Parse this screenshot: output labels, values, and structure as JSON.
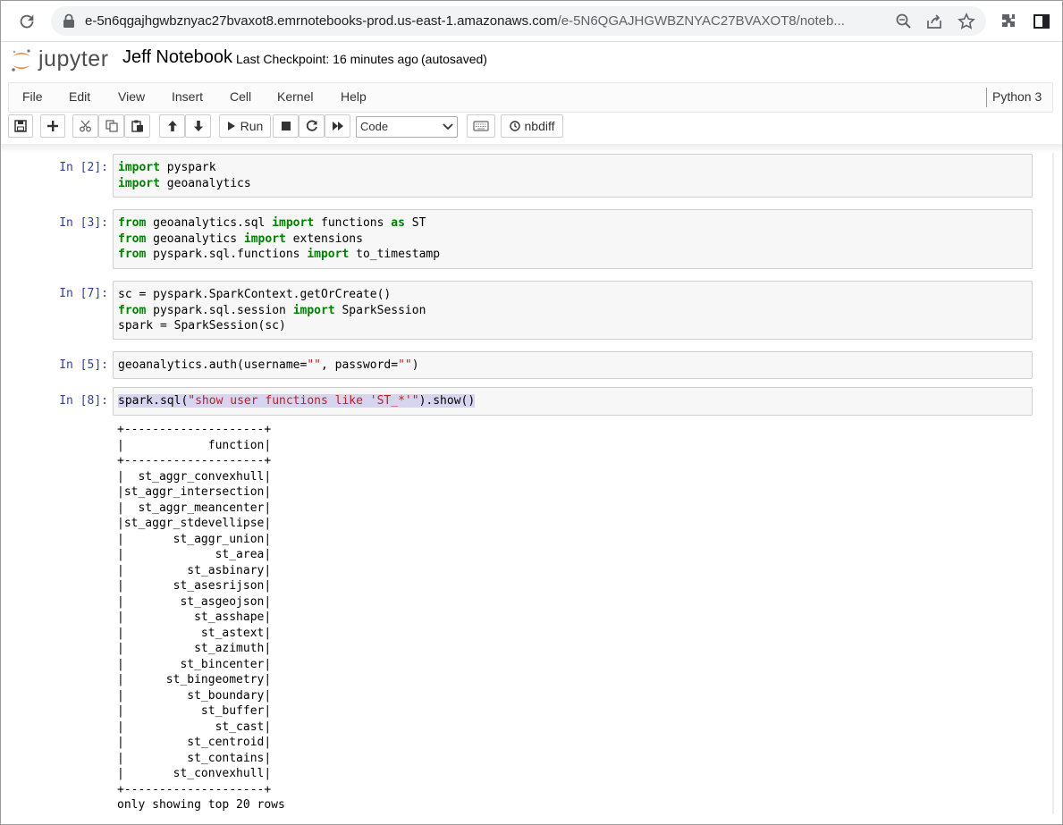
{
  "browser": {
    "url_domain": "e-5n6qgajhgwbznyac27bvaxot8.emrnotebooks-prod.us-east-1.amazonaws.com",
    "url_path": "/e-5N6QGAJHGWBZNYAC27BVAXOT8/noteb..."
  },
  "header": {
    "logo_text": "jupyter",
    "notebook_title": "Jeff Notebook",
    "checkpoint": "Last Checkpoint: 16 minutes ago",
    "autosave": "(autosaved)"
  },
  "menu": {
    "items": [
      "File",
      "Edit",
      "View",
      "Insert",
      "Cell",
      "Kernel",
      "Help"
    ],
    "kernel": "Python 3"
  },
  "toolbar": {
    "run_label": "Run",
    "cell_type": "Code",
    "nbdiff_label": "nbdiff"
  },
  "cells": [
    {
      "prompt": "In [2]:",
      "code": "import pyspark\nimport geoanalytics"
    },
    {
      "prompt": "In [3]:",
      "code": "from geoanalytics.sql import functions as ST\nfrom geoanalytics import extensions\nfrom pyspark.sql.functions import to_timestamp"
    },
    {
      "prompt": "In [7]:",
      "code": "sc = pyspark.SparkContext.getOrCreate()\nfrom pyspark.sql.session import SparkSession\nspark = SparkSession(sc)"
    },
    {
      "prompt": "In [5]:",
      "code": "geoanalytics.auth(username=\"\", password=\"\")"
    },
    {
      "prompt": "In [8]:",
      "code": "spark.sql(\"show user functions like 'ST_*'\").show()"
    }
  ],
  "output": {
    "border": "+--------------------+",
    "header": "function",
    "rows": [
      "st_aggr_convexhull",
      "st_aggr_intersection",
      "st_aggr_meancenter",
      "st_aggr_stdevellipse",
      "st_aggr_union",
      "st_area",
      "st_asbinary",
      "st_asesrijson",
      "st_asgeojson",
      "st_asshape",
      "st_astext",
      "st_azimuth",
      "st_bincenter",
      "st_bingeometry",
      "st_boundary",
      "st_buffer",
      "st_cast",
      "st_centroid",
      "st_contains",
      "st_convexhull"
    ],
    "footer": "only showing top 20 rows"
  },
  "colors": {
    "prompt": "#303f9f",
    "keyword": "#008000",
    "string": "#ba2121",
    "logo_orange": "#f37626"
  }
}
